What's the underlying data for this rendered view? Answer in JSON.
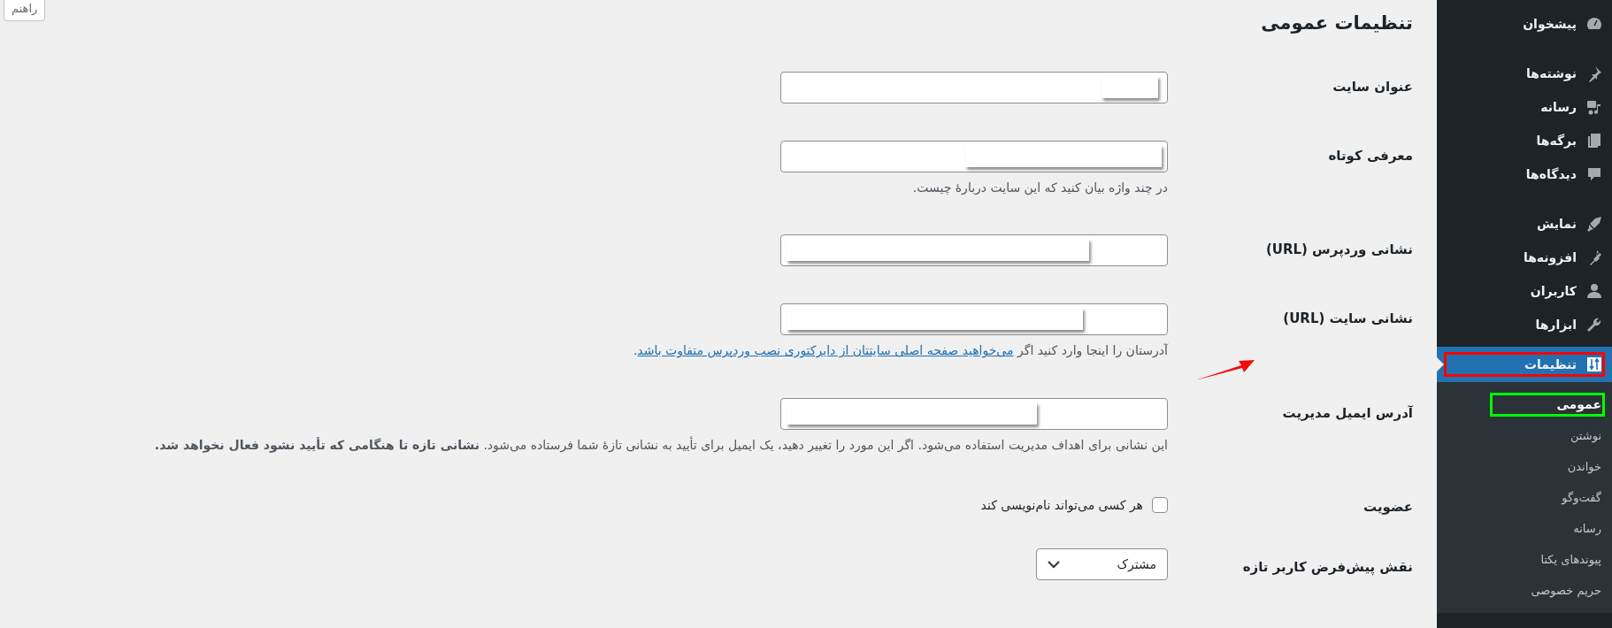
{
  "help_button": {
    "label": "راهنم"
  },
  "page_title": "تنظیمات عمومی",
  "fields": [
    {
      "kind": "text",
      "label": "عنوان سایت",
      "redacted": true
    },
    {
      "kind": "text",
      "label": "معرفی کوتاه",
      "redacted": true,
      "help": "در چند واژه بیان کنید که این سایت دربارهٔ چیست."
    },
    {
      "kind": "text",
      "label": "نشانی وردپرس (URL)",
      "redacted": true
    },
    {
      "kind": "text",
      "label": "نشانی سایت (URL)",
      "redacted": true,
      "help": "آدرستان را اینجا وارد کنید اگر",
      "help_link": "می‌خواهید صفحه اصلی سایتتان از دایرکتوری نصب وردپرس متفاوت باشد",
      "help_end": ".",
      "annotation_arrow": true
    },
    {
      "kind": "text",
      "label": "آدرس ایمیل مدیریت",
      "redacted": true,
      "help": "این نشانی برای اهداف مدیریت استفاده می‌شود. اگر این مورد را تغییر دهید، یک ایمیل برای تأیید به نشانی تازهٔ شما فرستاده می‌شود. **نشانی تازه تا هنگامی که تأیید نشود فعال نخواهد شد.**"
    },
    {
      "kind": "checkbox",
      "label": "عضویت",
      "option": "هر کسی می‌تواند نام‌نویسی کند",
      "checked": false
    },
    {
      "kind": "select",
      "label": "نقش پیش‌فرض کاربر تازه",
      "value": "مشترک"
    }
  ],
  "sidebar": {
    "groups": [
      {
        "items": [
          {
            "label": "پیشخوان",
            "selected": false
          }
        ]
      },
      {
        "items": [
          {
            "label": "نوشته‌ها",
            "selected": false
          },
          {
            "label": "رسانه",
            "selected": false
          },
          {
            "label": "برگه‌ها",
            "selected": false
          },
          {
            "label": "دیدگاه‌ها",
            "selected": false
          }
        ]
      },
      {
        "items": [
          {
            "label": "نمایش",
            "selected": false
          },
          {
            "label": "افزونه‌ها",
            "selected": false
          },
          {
            "label": "کاربران",
            "selected": false
          },
          {
            "label": "ابزارها",
            "selected": false
          },
          {
            "label": "تنظیمات",
            "selected": true,
            "color": "#ff0000",
            "children": [
              {
                "label": "عمومی",
                "selected": true,
                "color": "#00ff00"
              },
              {
                "label": "نوشتن",
                "selected": false
              },
              {
                "label": "خواندن",
                "selected": false
              },
              {
                "label": "گفت‌وگو",
                "selected": false
              },
              {
                "label": "رسانه",
                "selected": false
              },
              {
                "label": "پیوندهای یکتا",
                "selected": false
              },
              {
                "label": "حریم خصوصی",
                "selected": false
              }
            ]
          }
        ]
      }
    ]
  }
}
